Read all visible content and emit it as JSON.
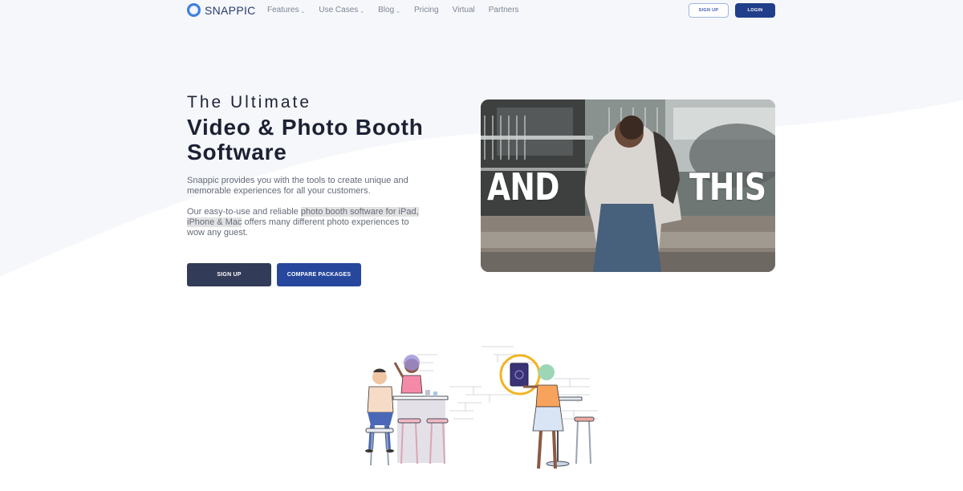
{
  "header": {
    "logo_text": "SNAPPIC",
    "nav": [
      {
        "label": "Features",
        "dropdown": true
      },
      {
        "label": "Use Cases",
        "dropdown": true
      },
      {
        "label": "Blog",
        "dropdown": true
      },
      {
        "label": "Pricing",
        "dropdown": false
      },
      {
        "label": "Virtual",
        "dropdown": false
      },
      {
        "label": "Partners",
        "dropdown": false
      }
    ],
    "signup_label": "SIGN UP",
    "login_label": "LOGIN"
  },
  "hero": {
    "eyebrow": "The Ultimate",
    "headline": "Video & Photo Booth Software",
    "description": "Snappic provides you with the tools to create unique and memorable experiences for all your customers.",
    "desc2_before": "Our easy-to-use and reliable ",
    "desc2_highlight": "photo booth software for iPad, iPhone & Mac",
    "desc2_after": " offers many different photo experiences to wow any guest.",
    "signup_label": "SIGN UP",
    "compare_label": "COMPARE PACKAGES"
  },
  "video": {
    "caption_left": "AND",
    "caption_right": "THIS"
  },
  "colors": {
    "brand_navy": "#213e8a",
    "button_dark": "#323b57",
    "button_blue": "#26479c",
    "logo_blue": "#3d7ee0"
  }
}
